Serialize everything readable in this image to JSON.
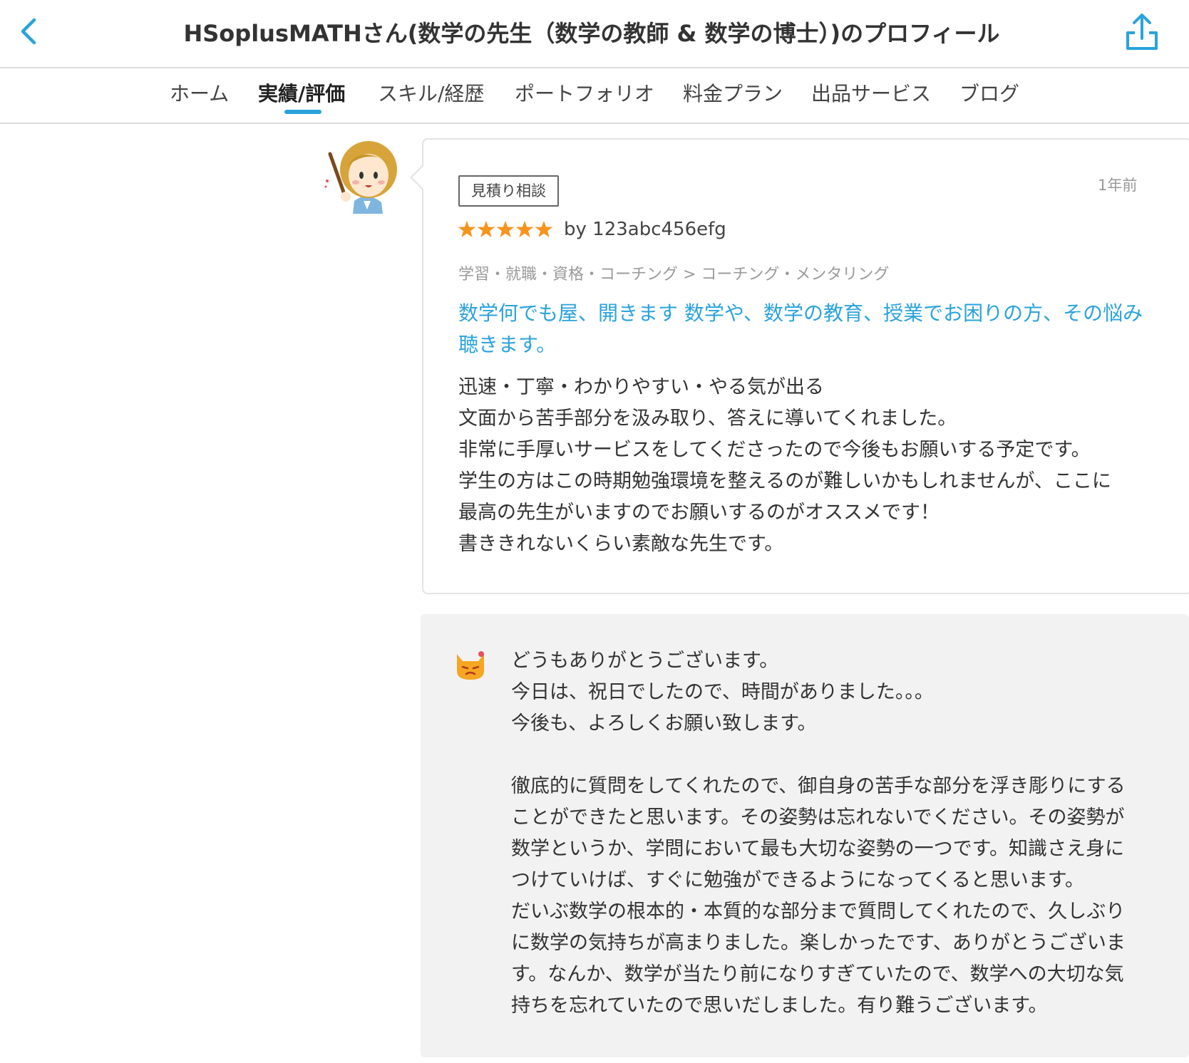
{
  "header": {
    "title": "HSoplusMATHさん(数学の先生（数学の教師 & 数学の博士）)のプロフィール",
    "back_icon": "chevron-left-icon",
    "share_icon": "share-icon",
    "accent_color": "#2aa3dc"
  },
  "tabs": [
    {
      "label": "ホーム",
      "active": false
    },
    {
      "label": "実績/評価",
      "active": true
    },
    {
      "label": "スキル/経歴",
      "active": false
    },
    {
      "label": "ポートフォリオ",
      "active": false
    },
    {
      "label": "料金プラン",
      "active": false
    },
    {
      "label": "出品サービス",
      "active": false
    },
    {
      "label": "ブログ",
      "active": false
    }
  ],
  "review": {
    "badge": "見積り相談",
    "timestamp": "1年前",
    "rating": 5,
    "star_color": "#f7941d",
    "reviewer": "by 123abc456efg",
    "category": "学習・就職・資格・コーチング > コーチング・メンタリング",
    "service_title": "数学何でも屋、開きます 数学や、数学の教育、授業でお困りの方、その悩み聴きます。",
    "body_lines": [
      "迅速・丁寧・わかりやすい・やる気が出る",
      "文面から苦手部分を汲み取り、答えに導いてくれました。",
      "非常に手厚いサービスをしてくださったので今後もお願いする予定です。",
      "学生の方はこの時期勉強環境を整えるのが難しいかもしれませんが、ここに",
      "最高の先生がいますのでお願いするのがオススメです！",
      "書ききれないくらい素敵な先生です。"
    ]
  },
  "reply": {
    "lines": [
      "どうもありがとうございます。",
      "今日は、祝日でしたので、時間がありました。。。",
      "今後も、よろしくお願い致します。",
      "",
      "徹底的に質問をしてくれたので、御自身の苦手な部分を浮き彫りにする",
      "ことができたと思います。その姿勢は忘れないでください。その姿勢が",
      "数学というか、学問において最も大切な姿勢の一つです。知識さえ身に",
      "つけていけば、すぐに勉強ができるようになってくると思います。",
      "だいぶ数学の根本的・本質的な部分まで質問してくれたので、久しぶり",
      "に数学の気持ちが高まりました。楽しかったです、ありがとうございま",
      "す。なんか、数学が当たり前になりすぎていたので、数学への大切な気",
      "持ちを忘れていたので思いだしました。有り難うございます。"
    ]
  }
}
